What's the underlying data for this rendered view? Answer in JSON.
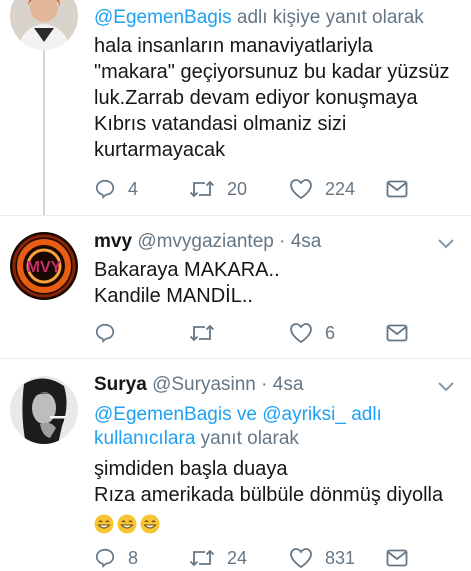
{
  "tweet1": {
    "replying_prefix": "@EgemenBagis",
    "replying_suffix": " adlı kişiye yanıt olarak",
    "lines": [
      "hala insanların manaviyatlariyla",
      "\"makara\" geçiyorsunuz bu kadar yüzsüz",
      "luk.Zarrab devam ediyor konuşmaya",
      "Kıbrıs vatandasi olmaniz sizi",
      "kurtarmayacak"
    ],
    "replies": "4",
    "retweets": "20",
    "likes": "224"
  },
  "tweet2": {
    "name": "mvy",
    "handle": "@mvygaziantep",
    "time": "· 4sa",
    "lines": [
      "Bakaraya MAKARA..",
      "Kandile MANDİL.."
    ],
    "replies": "",
    "retweets": "",
    "likes": "6"
  },
  "tweet3": {
    "name": "Surya",
    "handle": "@Suryasinn",
    "time": "· 4sa",
    "replying_mention1": "@EgemenBagis",
    "replying_and": " ve ",
    "replying_mention2": "@ayriksi_",
    "replying_mid": " adlı",
    "replying_mention3": "kullanıcılara",
    "replying_suffix": " yanıt olarak",
    "lines": [
      "şimdiden başla duaya",
      "Rıza amerikada bülbüle dönmüş diyolla"
    ],
    "replies": "8",
    "retweets": "24",
    "likes": "831"
  },
  "colors": {
    "link": "#1da1f2",
    "secondary": "#657786",
    "text": "#14171a",
    "divider": "#e6ecf0"
  },
  "icons": [
    "reply-icon",
    "retweet-icon",
    "like-icon",
    "share-icon",
    "caret-down-icon",
    "grin-emoji"
  ]
}
